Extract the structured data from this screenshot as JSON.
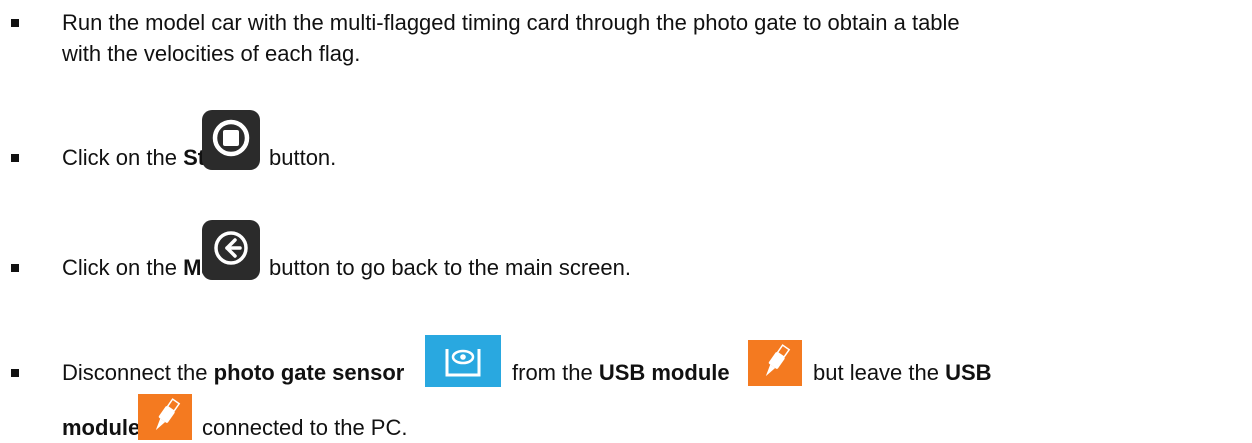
{
  "steps": [
    {
      "line1": "Run the model car with the multi-flagged timing card through the photo gate to obtain a table",
      "line2": "with the velocities of each flag."
    },
    {
      "pre": "Click on the ",
      "bold": "Stop",
      "post": "button.",
      "icon": "stop-icon"
    },
    {
      "pre": "Click on the ",
      "bold": "Main",
      "post": "button to go back to the main screen.",
      "icon": "back-arrow-icon"
    },
    {
      "pre": "Disconnect the ",
      "bold1": "photo gate sensor",
      "mid1": "from the ",
      "bold2": "USB module",
      "mid2": "but leave the ",
      "bold3": "USB",
      "bold4": "module",
      "post": "connected to the PC.",
      "icons": [
        "photo-gate-icon",
        "usb-module-icon",
        "usb-module-icon"
      ]
    }
  ],
  "colors": {
    "button_dark": "#2b2b2b",
    "photo_gate_blue": "#29a8e0",
    "usb_orange": "#f47a20"
  }
}
